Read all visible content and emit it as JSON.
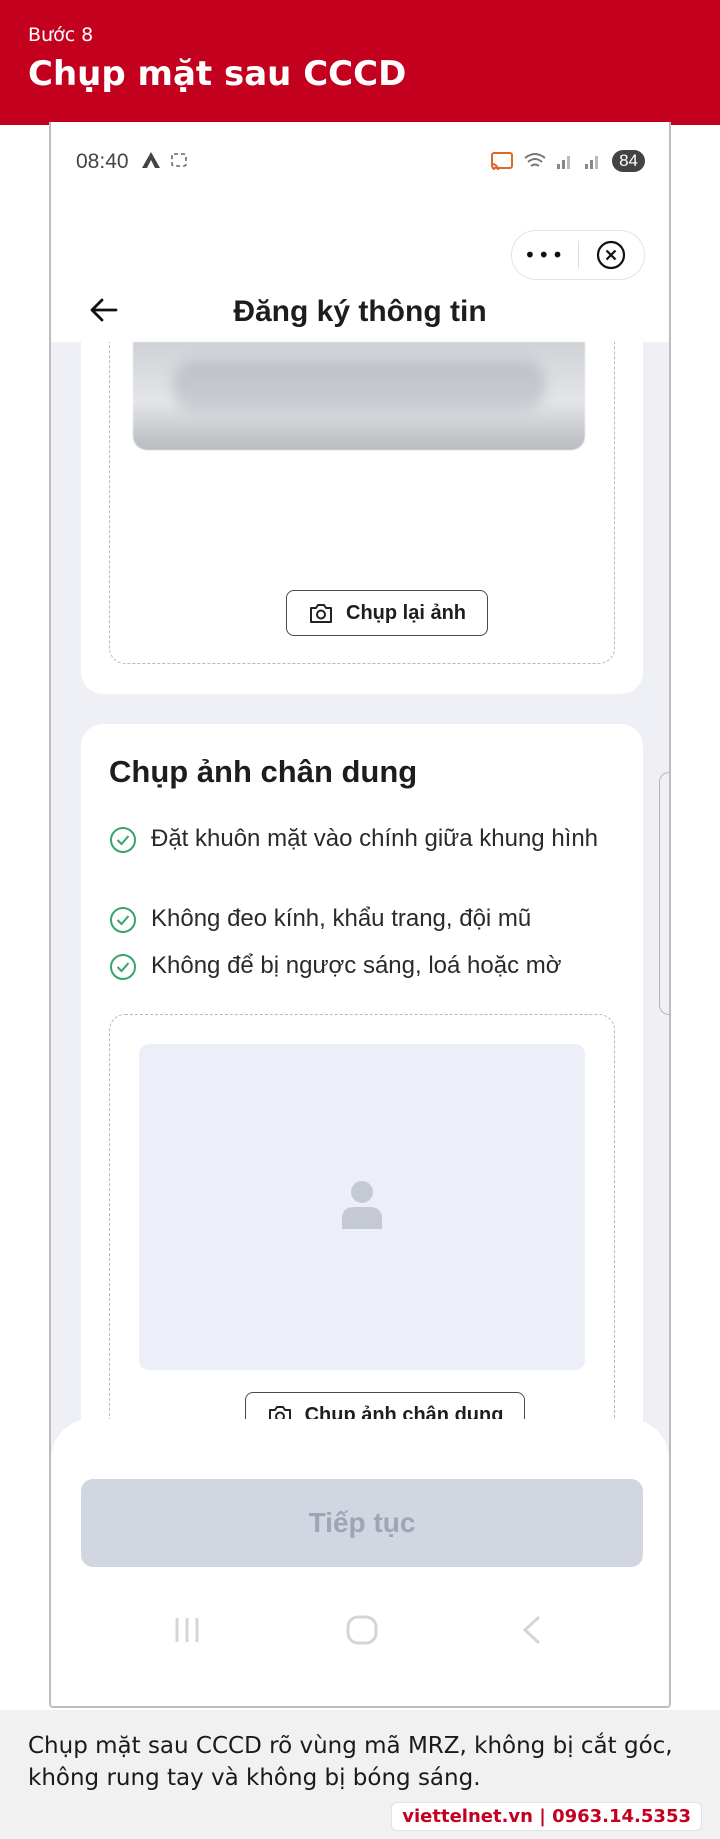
{
  "banner": {
    "step": "Bước 8",
    "title": "Chụp mặt sau CCCD"
  },
  "status_bar": {
    "time": "08:40",
    "battery": "84"
  },
  "header": {
    "title": "Đăng ký thông tin",
    "more_label": "•••"
  },
  "card_back": {
    "retake_label": "Chụp lại ảnh"
  },
  "card_portrait": {
    "title": "Chụp ảnh chân dung",
    "requirements": [
      "Đặt khuôn mặt vào chính giữa khung hình",
      "Không đeo kính, khẩu trang, đội mũ",
      "Không để bị ngược sáng, loá hoặc mờ"
    ],
    "capture_label": "Chụp ảnh chân dung"
  },
  "footer": {
    "continue_label": "Tiếp tục"
  },
  "caption": {
    "text": "Chụp mặt sau CCCD rõ vùng mã MRZ, không bị cắt góc, không rung tay và không bị bóng sáng.",
    "brand": "viettelnet.vn | 0963.14.5353"
  },
  "colors": {
    "brand_red": "#c4001f",
    "check_green": "#36a46b",
    "disabled_button": "#d2d6e1"
  }
}
